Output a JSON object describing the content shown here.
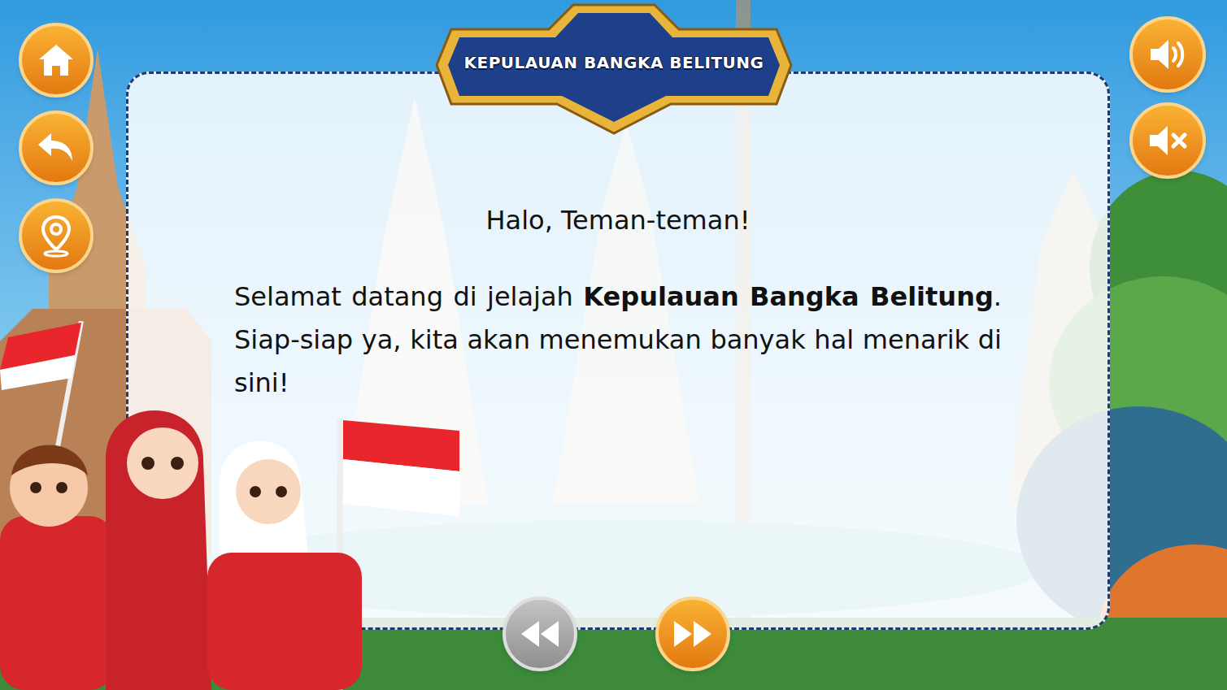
{
  "title": "KEPULAUAN BANGKA BELITUNG",
  "greeting": "Halo, Teman-teman!",
  "paragraph": [
    {
      "text": "Selamat datang di jelajah ",
      "bold": false
    },
    {
      "text": "Kepulauan Bangka Belitung",
      "bold": true
    },
    {
      "text": ". Siap-siap ya, kita akan menemukan banyak hal menarik di sini!",
      "bold": false
    }
  ],
  "nav": {
    "previous": {
      "disabled": true
    },
    "next": {
      "disabled": false
    }
  }
}
